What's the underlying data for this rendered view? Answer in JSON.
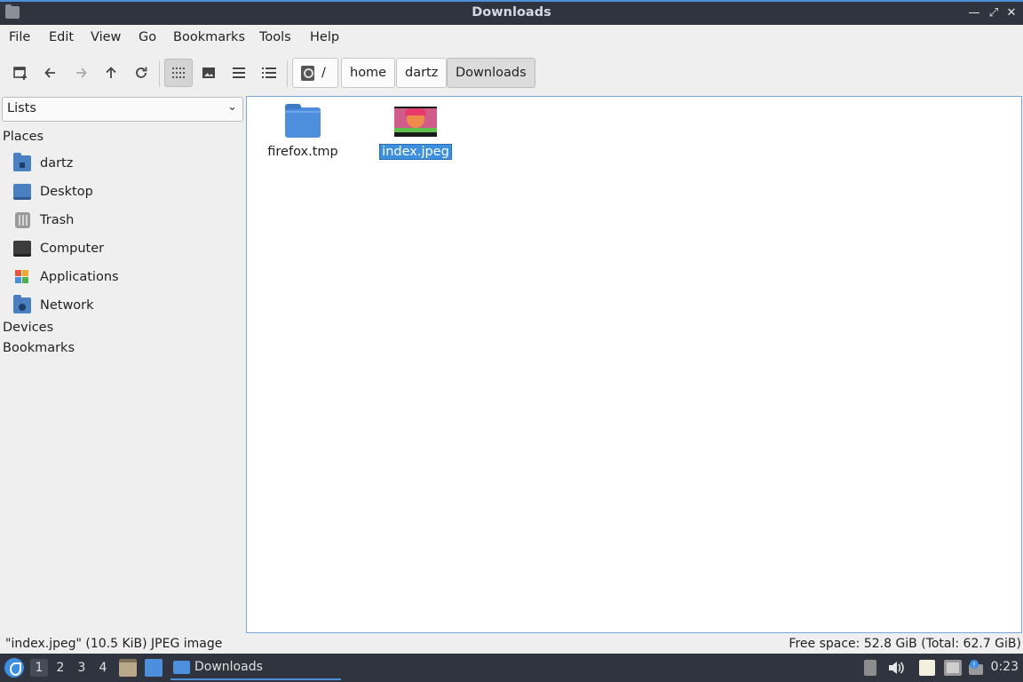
{
  "window": {
    "title": "Downloads",
    "controls": [
      "minimize",
      "maximize",
      "close"
    ]
  },
  "menu": {
    "items": [
      "File",
      "Edit",
      "View",
      "Go",
      "Bookmarks",
      "Tools",
      "Help"
    ]
  },
  "toolbar": {
    "buttons": [
      "new-tab",
      "back",
      "forward",
      "up",
      "reload",
      "icon-view",
      "thumbnail-view",
      "compact-view",
      "detailed-list-view"
    ],
    "active_view": "icon-view"
  },
  "breadcrumb": {
    "items": [
      "/",
      "home",
      "dartz",
      "Downloads"
    ],
    "active": "Downloads"
  },
  "sidebar": {
    "mode": "Lists",
    "places_header": "Places",
    "places": [
      {
        "label": "dartz",
        "icon": "home-folder-icon"
      },
      {
        "label": "Desktop",
        "icon": "desktop-icon"
      },
      {
        "label": "Trash",
        "icon": "trash-icon"
      },
      {
        "label": "Computer",
        "icon": "computer-icon"
      },
      {
        "label": "Applications",
        "icon": "applications-icon"
      },
      {
        "label": "Network",
        "icon": "network-icon"
      }
    ],
    "devices_header": "Devices",
    "bookmarks_header": "Bookmarks"
  },
  "files": [
    {
      "name": "firefox.tmp",
      "type": "folder",
      "selected": false
    },
    {
      "name": "index.jpeg",
      "type": "image",
      "selected": true
    }
  ],
  "status": {
    "selection": "\"index.jpeg\" (10.5 KiB) JPEG image",
    "free_space": "Free space: 52.8 GiB (Total: 62.7 GiB)"
  },
  "taskbar": {
    "workspaces": [
      "1",
      "2",
      "3",
      "4"
    ],
    "active_workspace": "1",
    "task_label": "Downloads",
    "clock": "0:23"
  },
  "colors": {
    "accent": "#4a90d9",
    "selection": "#3d8fe0",
    "titlebar": "#2f343f",
    "folder": "#4d8fdc"
  }
}
